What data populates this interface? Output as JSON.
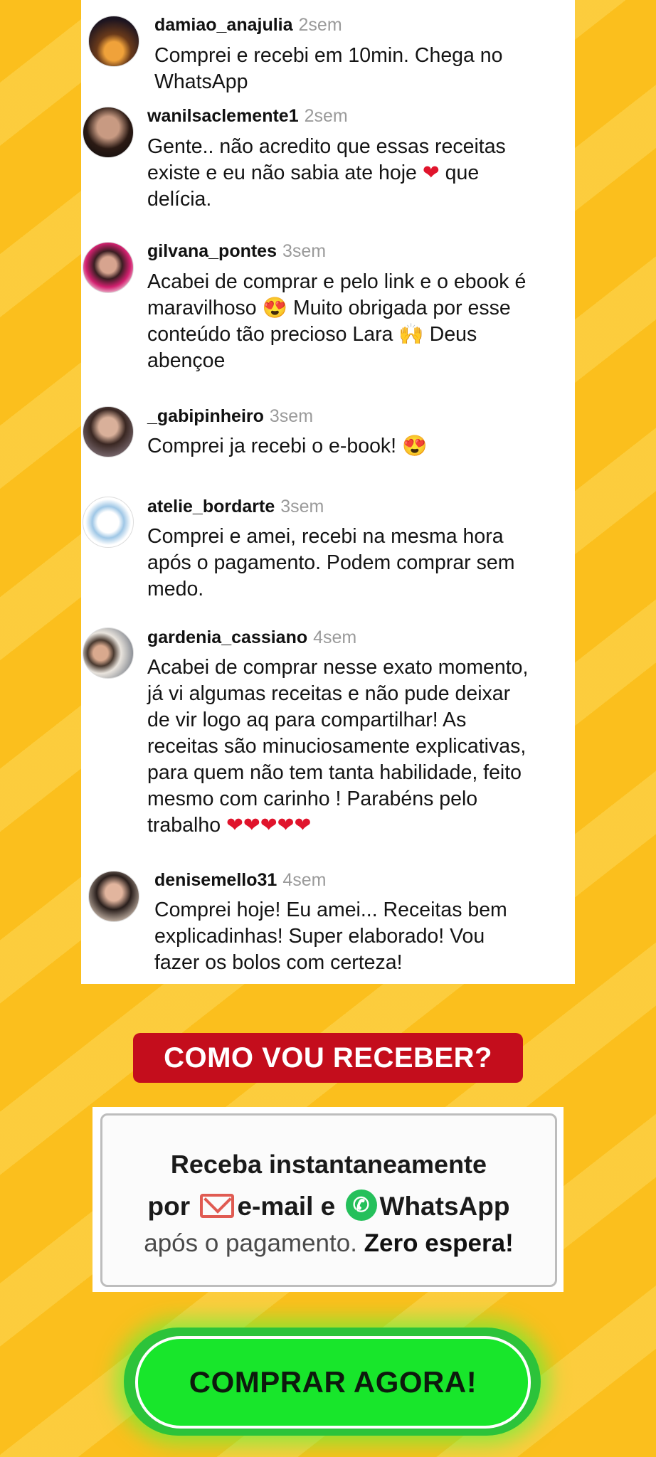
{
  "comments": [
    {
      "user": "damiao_anajulia",
      "time": "2sem",
      "lines": [
        "Comprei e recebi em 10min. Chega no",
        "WhatsApp"
      ]
    },
    {
      "user": "wanilsaclemente1",
      "time": "2sem",
      "lines": [
        "Gente.. não acredito que essas receitas",
        "existe e eu não sabia ate hoje ❤ que",
        "delícia."
      ]
    },
    {
      "user": "gilvana_pontes",
      "time": "3sem",
      "lines": [
        "Acabei de comprar e pelo link e o ebook é",
        "maravilhoso 😍 Muito obrigada por esse",
        "conteúdo tão precioso Lara 🙌 Deus",
        "abençoe"
      ]
    },
    {
      "user": "_gabipinheiro",
      "time": "3sem",
      "lines": [
        "Comprei ja recebi o e-book! 😍"
      ]
    },
    {
      "user": "atelie_bordarte",
      "time": "3sem",
      "lines": [
        "Comprei e amei, recebi na mesma hora",
        "após o pagamento. Podem comprar sem",
        "medo."
      ]
    },
    {
      "user": "gardenia_cassiano",
      "time": "4sem",
      "lines": [
        "Acabei de comprar nesse exato momento,",
        "já vi algumas receitas e não pude deixar",
        "de vir logo aq para compartilhar! As",
        "receitas são minuciosamente explicativas,",
        "para quem não tem tanta habilidade, feito",
        "mesmo com carinho ! Parabéns pelo",
        "trabalho ❤❤❤❤❤"
      ]
    },
    {
      "user": "denisemello31",
      "time": "4sem",
      "lines": [
        "Comprei hoje! Eu amei... Receitas bem",
        "explicadinhas! Super elaborado! Vou",
        "fazer os bolos com certeza!"
      ]
    }
  ],
  "section_title": "COMO VOU RECEBER?",
  "info": {
    "line1": "Receba instantaneamente",
    "line2_prefix": "por",
    "line2_mail": "e-mail e",
    "line2_app": "WhatsApp",
    "line3_light": "após o pagamento.",
    "line3_strong": "Zero espera!",
    "mail_icon": "mail-icon",
    "whatsapp_icon": "whatsapp-icon"
  },
  "buy_button": "COMPRAR AGORA!",
  "colors": {
    "background": "#fbbf1d",
    "title_bg": "#c40d1c",
    "button_bg": "#18e62b"
  }
}
